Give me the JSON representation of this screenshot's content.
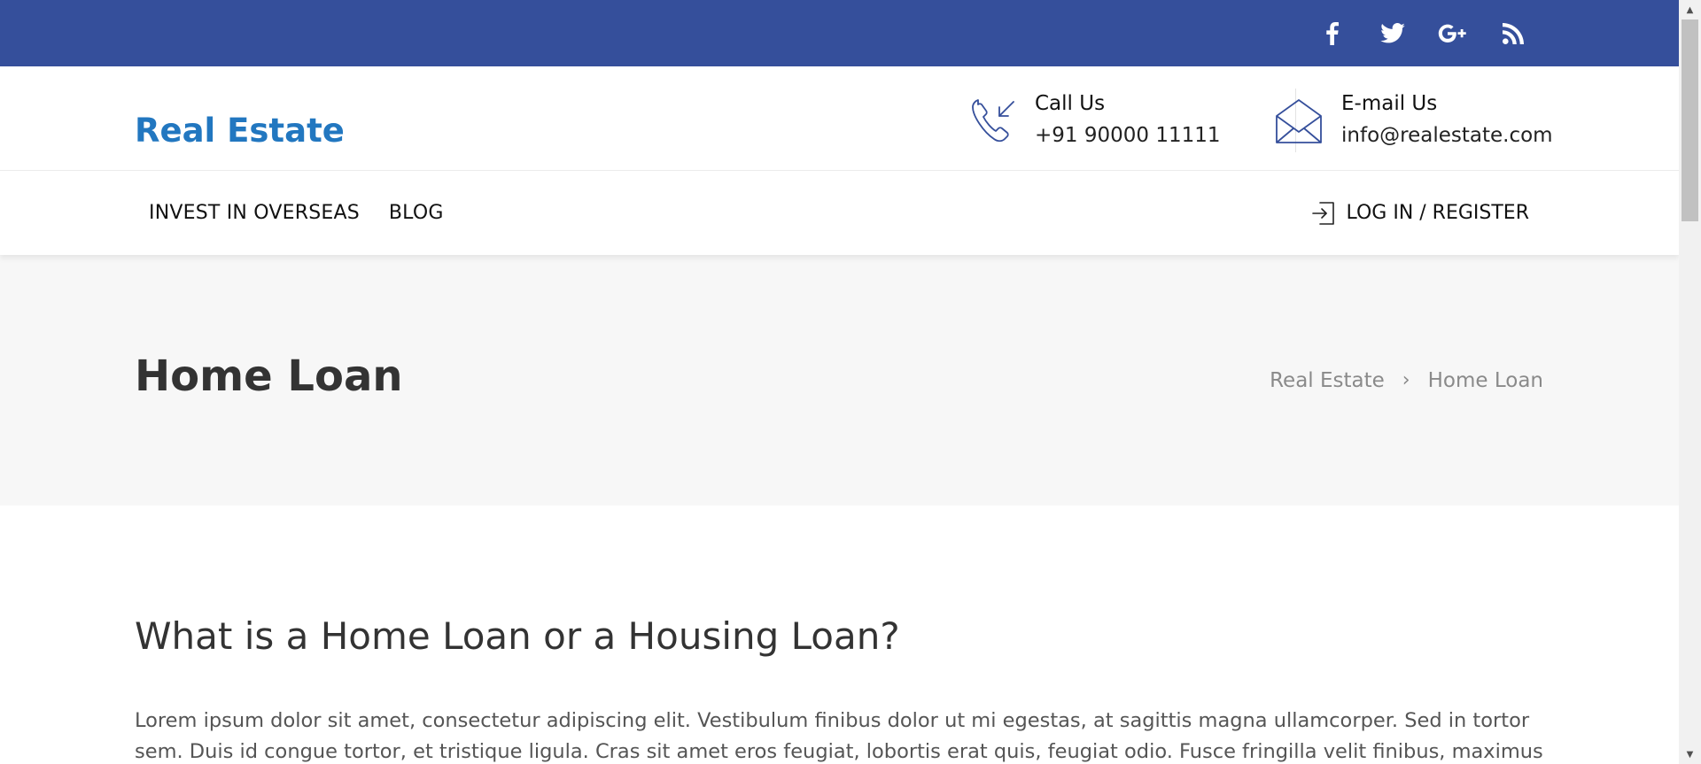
{
  "topbar": {
    "background": "#354f9b",
    "social": [
      {
        "icon": "facebook-icon"
      },
      {
        "icon": "twitter-icon"
      },
      {
        "icon": "google-plus-icon"
      },
      {
        "icon": "rss-icon"
      }
    ]
  },
  "header": {
    "logo": "Real Estate",
    "logo_color": "#2277c0",
    "call": {
      "label": "Call Us",
      "value": "+91 90000 11111",
      "icon": "phone-incoming-icon"
    },
    "email": {
      "label": "E-mail Us",
      "value": "info@realestate.com",
      "icon": "envelope-open-icon"
    }
  },
  "nav": {
    "items": [
      "INVEST IN OVERSEAS",
      "BLOG"
    ],
    "login": "LOG IN / REGISTER",
    "login_icon": "login-icon"
  },
  "page_title": {
    "title": "Home Loan",
    "breadcrumb": [
      "Real Estate",
      "Home Loan"
    ],
    "breadcrumb_separator": "›"
  },
  "content": {
    "heading": "What is a Home Loan or a Housing Loan?",
    "paragraph": "Lorem ipsum dolor sit amet, consectetur adipiscing elit. Vestibulum finibus dolor ut mi egestas, at sagittis magna ullamcorper. Sed in tortor sem. Duis id congue tortor, et tristique ligula. Cras sit amet eros feugiat, lobortis erat quis, feugiat odio. Fusce fringilla velit finibus, maximus erat a, auctor justo."
  }
}
